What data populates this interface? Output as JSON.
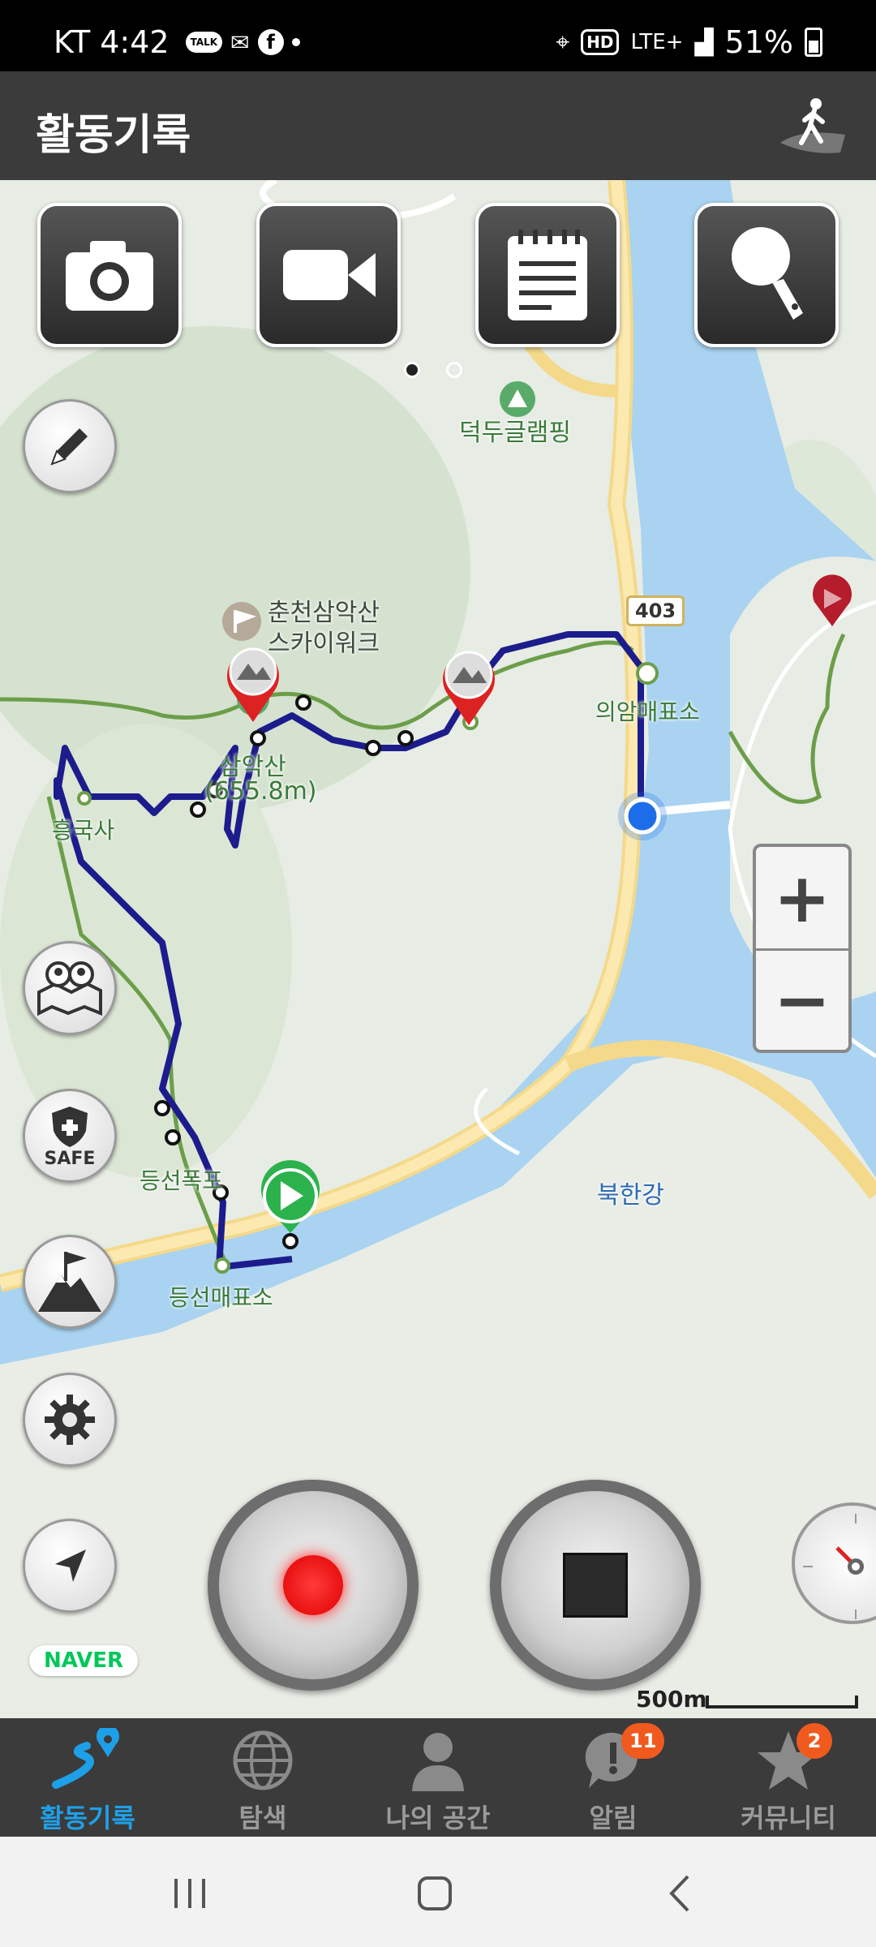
{
  "status_bar": {
    "carrier_time": "KT 4:42",
    "talk_label": "TALK",
    "facebook_label": "f",
    "hd_label": "HD",
    "network": "LTE+",
    "battery": "51%"
  },
  "header": {
    "title": "활동기록"
  },
  "map": {
    "labels": {
      "glamping": "덕두글램핑",
      "skywalk_line1": "춘천삼악산",
      "skywalk_line2": "스카이워크",
      "mountain_name": "삼악산",
      "mountain_height": "(655.8m)",
      "temple": "흥국사",
      "waterfall": "등선폭포",
      "deungseon_ticket": "등선매표소",
      "uiam_ticket": "의암매표소",
      "river": "북한강",
      "edge_text": "의암"
    },
    "road_number": "403",
    "zoom_in": "+",
    "zoom_out": "−",
    "safe_label": "SAFE",
    "naver_logo": "NAVER",
    "scale": "500m"
  },
  "bottom_nav": {
    "items": [
      {
        "label": "활동기록",
        "active": true
      },
      {
        "label": "탐색"
      },
      {
        "label": "나의 공간"
      },
      {
        "label": "알림",
        "badge": "11"
      },
      {
        "label": "커뮤니티",
        "badge": "2"
      }
    ]
  },
  "colors": {
    "header_bg": "#3b3b3b",
    "active_tab": "#1ea0e8",
    "badge": "#f05a1e",
    "track": "#1c1c8c",
    "water": "#a9d3f0"
  }
}
